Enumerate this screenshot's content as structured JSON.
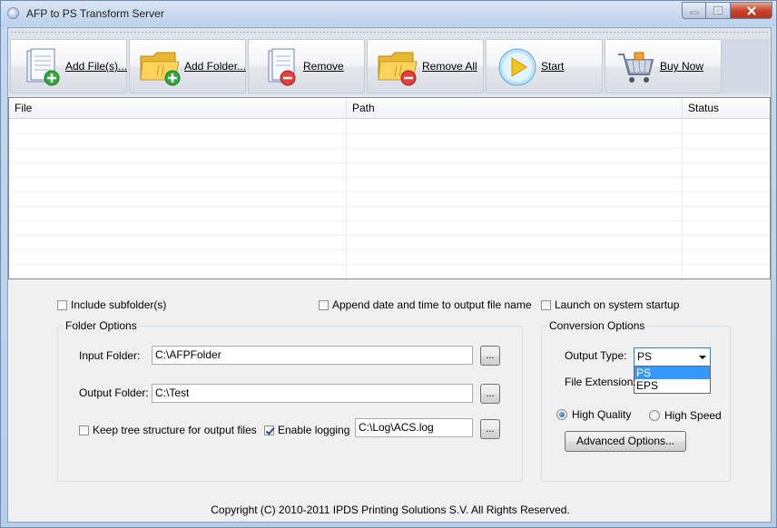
{
  "window": {
    "title": "AFP to PS Transform Server",
    "caption_buttons": {
      "minimize": "minimize-icon",
      "maximize": "maximize-icon",
      "close": "close-icon"
    }
  },
  "toolbar": {
    "buttons": [
      {
        "label": "Add File(s)...",
        "icon": "add-file-icon"
      },
      {
        "label": "Add Folder...",
        "icon": "add-folder-icon"
      },
      {
        "label": "Remove",
        "icon": "remove-file-icon"
      },
      {
        "label": "Remove All",
        "icon": "remove-folder-icon"
      },
      {
        "label": "Start",
        "icon": "play-icon"
      },
      {
        "label": "Buy Now",
        "icon": "shopping-cart-icon"
      }
    ]
  },
  "file_list": {
    "columns": [
      "File",
      "Path",
      "Status"
    ],
    "rows": []
  },
  "options": {
    "include_subfolders": {
      "label": "Include subfolder(s)",
      "checked": false
    },
    "append_datetime": {
      "label": "Append date and time to output file name",
      "checked": false
    },
    "launch_on_startup": {
      "label": "Launch on system startup",
      "checked": false
    },
    "folder_options": {
      "title": "Folder Options",
      "input_folder_label": "Input Folder:",
      "input_folder_value": "C:\\AFPFolder",
      "output_folder_label": "Output Folder:",
      "output_folder_value": "C:\\Test",
      "keep_tree": {
        "label": "Keep tree structure for output files",
        "checked": false
      },
      "enable_logging": {
        "label": "Enable logging",
        "checked": true
      },
      "log_file_value": "C:\\Log\\ACS.log",
      "browse_label": "..."
    },
    "conversion_options": {
      "title": "Conversion Options",
      "output_type_label": "Output Type:",
      "output_type_value": "PS",
      "output_type_options": [
        "PS",
        "EPS"
      ],
      "file_extension_label": "File Extension:",
      "high_quality": {
        "label": "High Quality",
        "selected": true
      },
      "high_speed": {
        "label": "High Speed",
        "selected": false
      },
      "advanced_button": "Advanced Options..."
    }
  },
  "footer": {
    "copyright": "Copyright (C) 2010-2011 IPDS Printing Solutions S.V.  All Rights Reserved."
  },
  "colors": {
    "title_gradient": "#bcd1ea",
    "close_button": "#c7452b",
    "selection": "#3399ff",
    "panel": "#f0f0f0"
  }
}
